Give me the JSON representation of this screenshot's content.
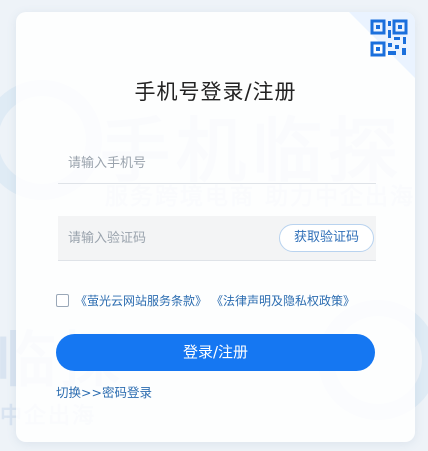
{
  "watermark": {
    "brand_large": "手机临探",
    "brand_tagline": "服务跨境电商 助力中企出海",
    "brand_large_2": "临探",
    "brand_tagline_2": "中企出海"
  },
  "login": {
    "title": "手机号登录/注册",
    "phone_placeholder": "请输入手机号",
    "phone_value": "",
    "code_placeholder": "请输入验证码",
    "code_value": "",
    "get_code_label": "获取验证码",
    "agreement_checked": false,
    "terms_link": "《萤光云网站服务条款》",
    "privacy_link": "《法律声明及隐私权政策》",
    "submit_label": "登录/注册",
    "switch_label": "切换>>密码登录"
  },
  "colors": {
    "primary": "#1577f2",
    "link": "#2b6cb0",
    "qr_accent": "#1a6fdc"
  },
  "icons": {
    "qr_corner": "qr-code-icon"
  }
}
